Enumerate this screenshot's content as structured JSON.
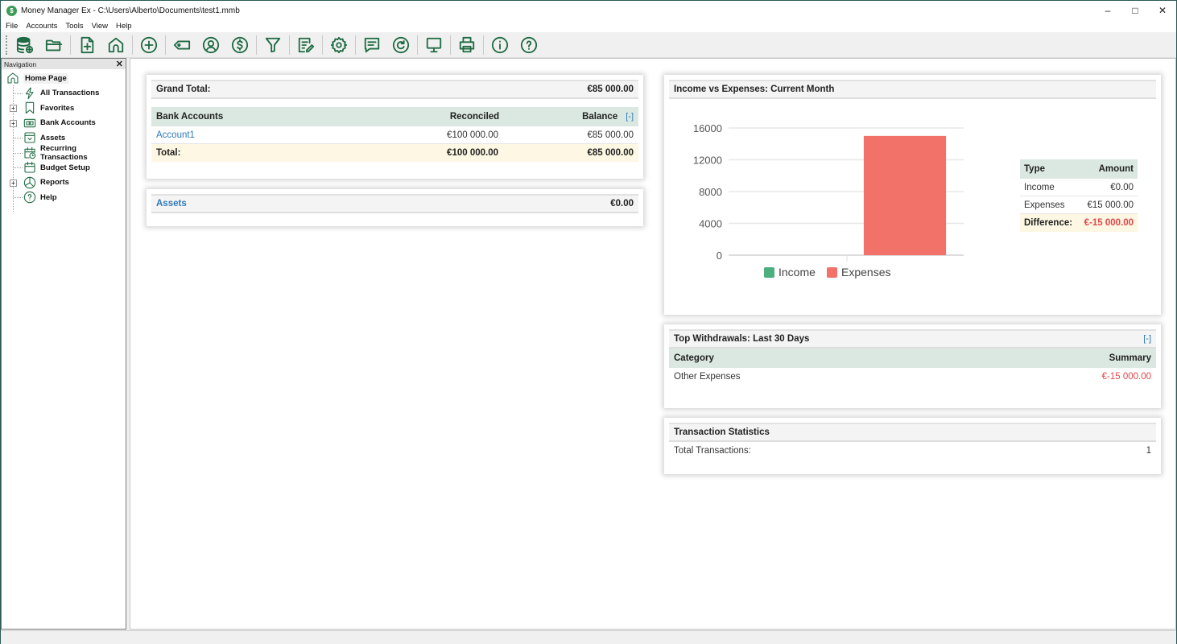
{
  "window": {
    "title": "Money Manager Ex - C:\\Users\\Alberto\\Documents\\test1.mmb",
    "app_icon_glyph": "$",
    "controls": {
      "minimize": "–",
      "maximize": "□",
      "close": "✕"
    }
  },
  "menu": [
    "File",
    "Accounts",
    "Tools",
    "View",
    "Help"
  ],
  "toolbar": [
    {
      "name": "new-database-icon"
    },
    {
      "name": "open-database-icon"
    },
    {
      "sep": true
    },
    {
      "name": "new-account-icon"
    },
    {
      "name": "home-page-icon"
    },
    {
      "sep": true
    },
    {
      "name": "new-transaction-icon"
    },
    {
      "sep": true
    },
    {
      "name": "tag-icon"
    },
    {
      "name": "payee-icon"
    },
    {
      "name": "currency-icon"
    },
    {
      "sep": true
    },
    {
      "name": "filter-icon"
    },
    {
      "sep": true
    },
    {
      "name": "edit-report-icon"
    },
    {
      "sep": true
    },
    {
      "name": "settings-gear-icon"
    },
    {
      "sep": true
    },
    {
      "name": "feedback-icon"
    },
    {
      "name": "refresh-icon"
    },
    {
      "sep": true
    },
    {
      "name": "fullscreen-monitor-icon"
    },
    {
      "sep": true
    },
    {
      "name": "print-icon"
    },
    {
      "sep": true
    },
    {
      "name": "about-info-icon"
    },
    {
      "name": "help-icon"
    }
  ],
  "navigation": {
    "title": "Navigation",
    "close": "✕",
    "home": "Home Page",
    "items": [
      {
        "label": "All Transactions",
        "icon": "lightning-icon",
        "expandable": false
      },
      {
        "label": "Favorites",
        "icon": "bookmark-icon",
        "expandable": true
      },
      {
        "label": "Bank Accounts",
        "icon": "bank-icon",
        "expandable": true
      },
      {
        "label": "Assets",
        "icon": "assets-icon",
        "expandable": false
      },
      {
        "label": "Recurring Transactions",
        "icon": "recurring-calendar-icon",
        "expandable": false
      },
      {
        "label": "Budget Setup",
        "icon": "calendar-icon",
        "expandable": false
      },
      {
        "label": "Reports",
        "icon": "pie-chart-icon",
        "expandable": true
      },
      {
        "label": "Help",
        "icon": "help-icon",
        "expandable": false
      }
    ]
  },
  "grand_total": {
    "label": "Grand Total:",
    "value": "€85 000.00"
  },
  "bank_accounts": {
    "headers": [
      "Bank Accounts",
      "Reconciled",
      "Balance"
    ],
    "collapse": "[-]",
    "rows": [
      {
        "name": "Account1",
        "reconciled": "€100 000.00",
        "balance": "€85 000.00"
      }
    ],
    "total": {
      "label": "Total:",
      "reconciled": "€100 000.00",
      "balance": "€85 000.00"
    }
  },
  "assets": {
    "label": "Assets",
    "value": "€0.00"
  },
  "income_expenses": {
    "title": "Income vs Expenses: Current Month",
    "table": {
      "headers": [
        "Type",
        "Amount"
      ],
      "rows": [
        {
          "type": "Income",
          "amount": "€0.00"
        },
        {
          "type": "Expenses",
          "amount": "€15 000.00"
        }
      ],
      "difference": {
        "label": "Difference:",
        "amount": "€-15 000.00"
      }
    }
  },
  "chart_data": {
    "type": "bar",
    "title": "Income vs Expenses: Current Month",
    "categories": [
      ""
    ],
    "series": [
      {
        "name": "Income",
        "values": [
          0
        ],
        "color": "#4caf7d"
      },
      {
        "name": "Expenses",
        "values": [
          15000
        ],
        "color": "#f2726a"
      }
    ],
    "ylim": [
      0,
      16000
    ],
    "yticks": [
      0,
      4000,
      8000,
      12000,
      16000
    ],
    "grid": true,
    "legend": "bottom",
    "xlabel": "",
    "ylabel": ""
  },
  "top_withdrawals": {
    "title": "Top Withdrawals: Last 30 Days",
    "collapse": "[-]",
    "headers": [
      "Category",
      "Summary"
    ],
    "rows": [
      {
        "category": "Other Expenses",
        "summary": "€-15 000.00"
      }
    ]
  },
  "transaction_stats": {
    "title": "Transaction Statistics",
    "rows": [
      {
        "label": "Total Transactions:",
        "value": "1"
      }
    ]
  },
  "colors": {
    "accent": "#1f6b43",
    "link": "#2f7ab8",
    "negative": "#e0474c",
    "table_head": "#dbe8e2",
    "total_row": "#fdf7e3"
  }
}
